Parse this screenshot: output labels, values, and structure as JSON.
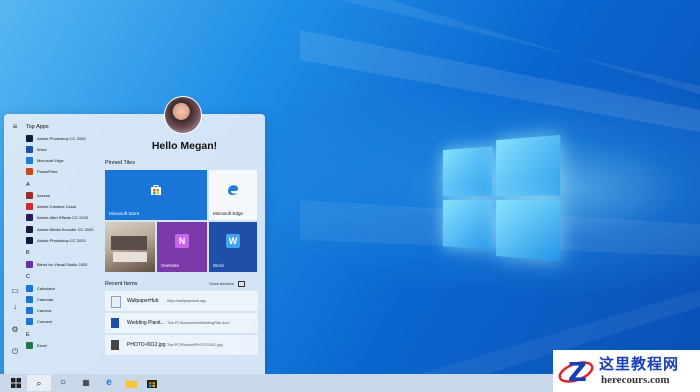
{
  "colors": {
    "accent": "#0a66cf",
    "tile_blue": "#1976d8",
    "onenote": "#7b3aa8",
    "word": "#1f4fa8"
  },
  "start_rail_icons": [
    "hamburger-icon",
    "document-icon",
    "download-icon",
    "settings-icon",
    "power-icon"
  ],
  "app_list": {
    "top_apps_label": "Top Apps",
    "top_apps": [
      {
        "label": "Adobe Photoshop CC 2020",
        "icon": "photoshop-icon",
        "color": "#0b1d3d"
      },
      {
        "label": "Word",
        "icon": "word-icon",
        "color": "#1f4fa8"
      },
      {
        "label": "Microsoft Edge",
        "icon": "edge-icon",
        "color": "#1d7fd6"
      },
      {
        "label": "PowerPoint",
        "icon": "powerpoint-icon",
        "color": "#c64a21"
      }
    ],
    "a_label": "A",
    "a_apps": [
      {
        "label": "Access",
        "icon": "access-icon",
        "color": "#9e2a2a"
      },
      {
        "label": "Adobe Creative Cloud",
        "icon": "creative-cloud-icon",
        "color": "#d8262e"
      },
      {
        "label": "Adobe After Effects CC 2020",
        "icon": "after-effects-icon",
        "color": "#2a1b57"
      },
      {
        "label": "Adobe Media Encoder CC 2020",
        "icon": "media-encoder-icon",
        "color": "#1a1a40"
      },
      {
        "label": "Adobe Photoshop CC 2020",
        "icon": "photoshop-icon",
        "color": "#0b1d3d"
      }
    ],
    "b_label": "B",
    "b_apps": [
      {
        "label": "Blend for Visual Studio 2020",
        "icon": "blend-icon",
        "color": "#6a2fa0"
      }
    ],
    "c_label": "C",
    "c_apps": [
      {
        "label": "Calculator",
        "icon": "calculator-icon",
        "color": "#1976d8"
      },
      {
        "label": "Calendar",
        "icon": "calendar-icon",
        "color": "#1976d8"
      },
      {
        "label": "Camera",
        "icon": "camera-icon",
        "color": "#1976d8"
      },
      {
        "label": "Connect",
        "icon": "connect-icon",
        "color": "#1976d8"
      }
    ],
    "e_label": "E",
    "e_apps": [
      {
        "label": "Excel",
        "icon": "excel-icon",
        "color": "#1e7a45"
      }
    ]
  },
  "greeting": "Hello Megan!",
  "pinned_title": "Pinned Tiles",
  "tiles": {
    "store": "Microsoft Store",
    "edge": "Microsoft Edge",
    "onenote": "OneNote",
    "word": "Word"
  },
  "recent": {
    "title": "Recent Items",
    "show_timeline": "Show timeline",
    "items": [
      {
        "name": "WallpaperHub",
        "path": "https://wallpaperhub.app",
        "icon": "web-file-icon"
      },
      {
        "name": "Wedding Planit...",
        "path": "This PC\\Documents\\WeddingPlan.docx",
        "icon": "word-file-icon"
      },
      {
        "name": "PHOTO-0012.jpg",
        "path": "This PC\\Pictures\\PHOTO-0012.jpg",
        "icon": "image-file-icon"
      }
    ]
  },
  "taskbar": {
    "icons": [
      "windows-start-icon",
      "search-icon",
      "task-view-icon",
      "apps-icon",
      "edge-icon",
      "file-explorer-icon",
      "store-icon"
    ]
  },
  "watermark": {
    "title": "这里教程网",
    "url": "herecours.com"
  }
}
